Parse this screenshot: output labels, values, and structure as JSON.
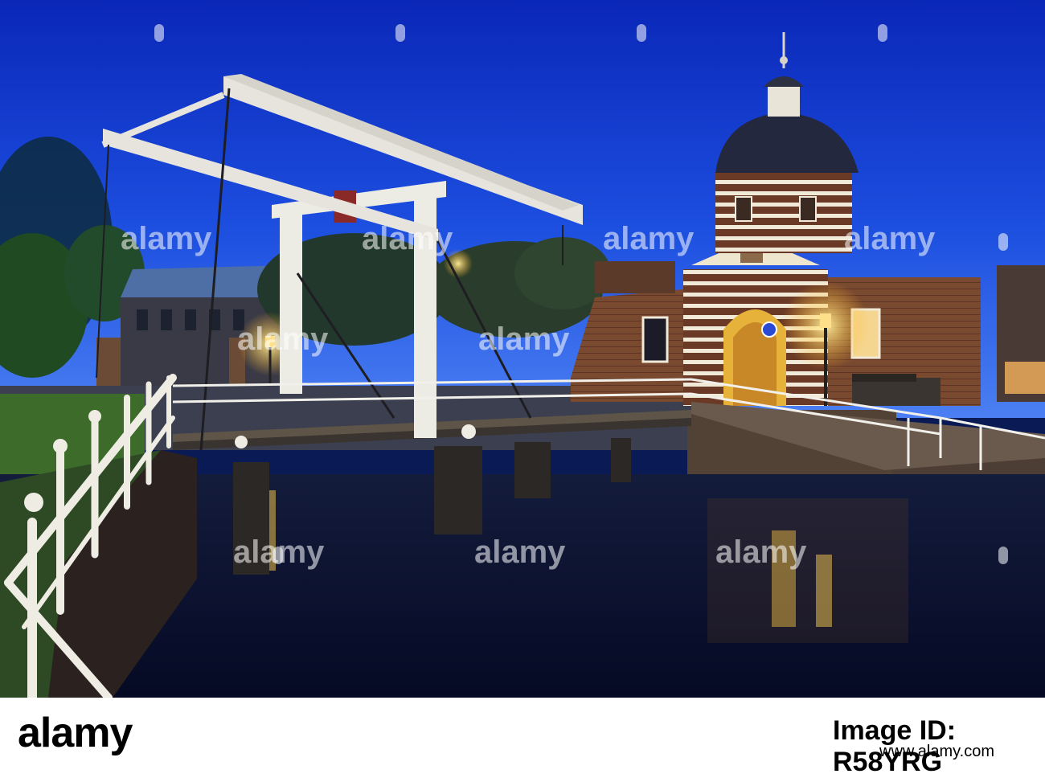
{
  "photo": {
    "description_colors": {
      "sky_top": "#0b2cc4",
      "sky_bottom": "#3b6ff0",
      "water": "#050a28",
      "bridge": "#e8e6df",
      "gate_brick": "#5a3626",
      "lamp_glow": "#ffd25a"
    },
    "watermark": "alamy"
  },
  "footer": {
    "logo": "alamy",
    "image_id_label": "Image ID: R58YRG",
    "site": "www.alamy.com"
  },
  "icons": {
    "lamp": "street-lamp-icon",
    "coat_of_arms": "coat-of-arms-icon",
    "sign": "pedestrian-sign-icon"
  }
}
